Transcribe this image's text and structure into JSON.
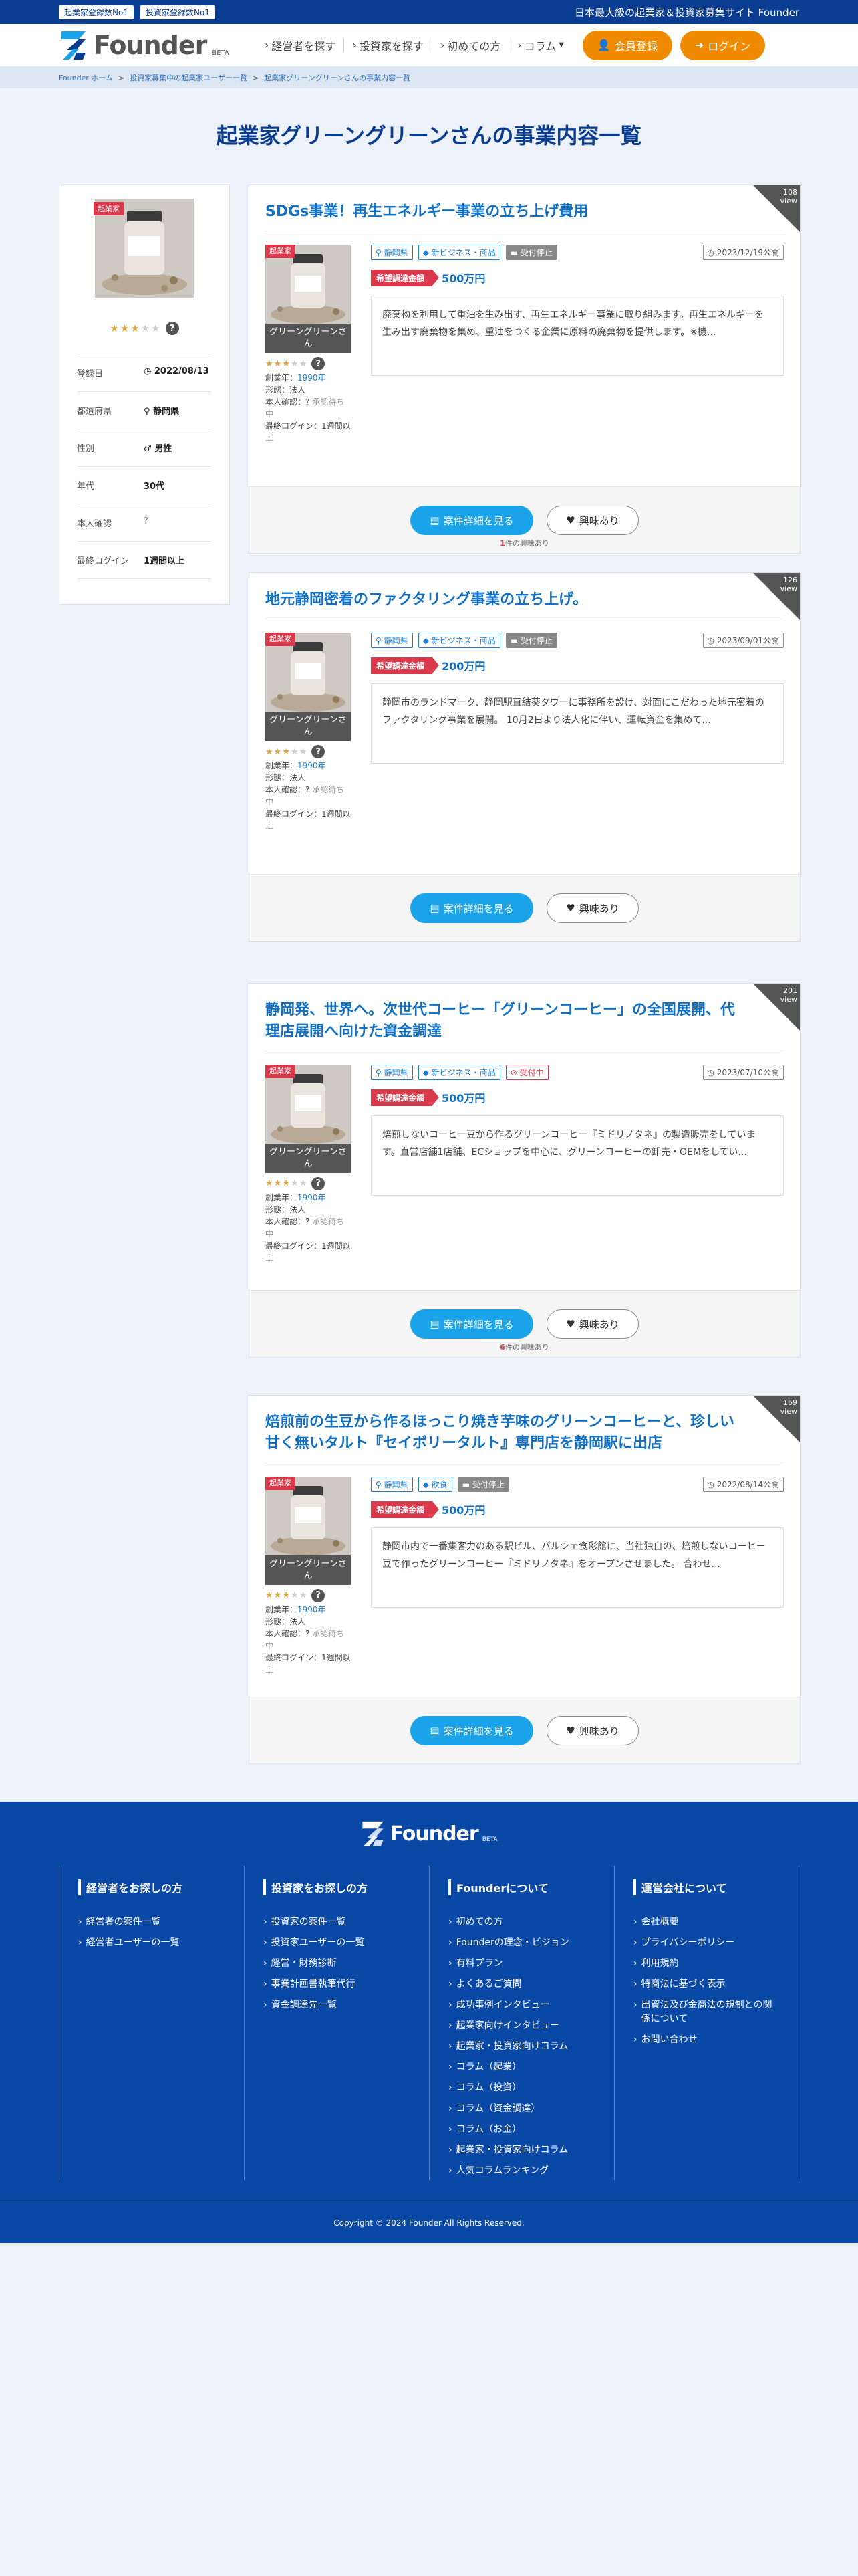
{
  "topbar": {
    "badge1": "起業家登録数No1",
    "badge2": "投資家登録数No1",
    "tagline": "日本最大級の起業家＆投資家募集サイト Founder"
  },
  "header": {
    "logo": "Founder",
    "beta": "BETA",
    "nav": [
      "経営者を探す",
      "投資家を探す",
      "初めての方",
      "コラム"
    ],
    "register": "会員登録",
    "login": "ログイン"
  },
  "breadcrumb": [
    "Founder ホーム",
    "投資家募集中の起業家ユーザー一覧",
    "起業家グリーングリーンさんの事業内容一覧"
  ],
  "page_title": "起業家グリーングリーンさんの事業内容一覧",
  "profile": {
    "tag": "起業家",
    "stars": 2.5,
    "q": "?",
    "rows": [
      {
        "k": "登録日",
        "v": "2022/08/13",
        "icon": "clock"
      },
      {
        "k": "都道府県",
        "v": "静岡県",
        "icon": "pin"
      },
      {
        "k": "性別",
        "v": "男性",
        "icon": "male"
      },
      {
        "k": "年代",
        "v": "30代",
        "icon": ""
      },
      {
        "k": "本人確認",
        "v": "?",
        "icon": ""
      },
      {
        "k": "最終ログイン",
        "v": "1週間以上",
        "icon": ""
      }
    ]
  },
  "cards": [
    {
      "title": "SDGs事業！再生エネルギー事業の立ち上げ費用",
      "views": "108",
      "view_label": "view",
      "tag": "起業家",
      "owner": "グリーングリーンさん",
      "founded_label": "創業年：",
      "founded": "1990年",
      "form": "形態：法人",
      "verify_label": "本人確認：?",
      "verify_status": "承認待ち中",
      "last_login": "最終ログイン：1週間以上",
      "pref": "静岡県",
      "category": "新ビジネス・商品",
      "status": "受付停止",
      "status_type": "gray",
      "date": "2023/12/19公開",
      "fund_label": "希望調達金額",
      "amount": "500万円",
      "desc": "廃棄物を利用して重油を生み出す、再生エネルギー事業に取り組みます。再生エネルギーを生み出す廃棄物を集め、重油をつくる企業に原料の廃棄物を提供します。※機...",
      "detail_btn": "案件詳細を見る",
      "interest_btn": "興味あり",
      "count": "1",
      "count_suffix": "件の興味あり"
    },
    {
      "title": "地元静岡密着のファクタリング事業の立ち上げ。",
      "views": "126",
      "view_label": "view",
      "tag": "起業家",
      "owner": "グリーングリーンさん",
      "founded_label": "創業年：",
      "founded": "1990年",
      "form": "形態：法人",
      "verify_label": "本人確認：?",
      "verify_status": "承認待ち中",
      "last_login": "最終ログイン：1週間以上",
      "pref": "静岡県",
      "category": "新ビジネス・商品",
      "status": "受付停止",
      "status_type": "gray",
      "date": "2023/09/01公開",
      "fund_label": "希望調達金額",
      "amount": "200万円",
      "desc": "静岡市のランドマーク、静岡駅直結葵タワーに事務所を設け、対面にこだわった地元密着のファクタリング事業を展開。 10月2日より法人化に伴い、運転資金を集めて...",
      "detail_btn": "案件詳細を見る",
      "interest_btn": "興味あり",
      "count": "",
      "count_suffix": ""
    },
    {
      "title": "静岡発、世界へ。次世代コーヒー「グリーンコーヒー」の全国展開、代理店展開へ向けた資金調達",
      "views": "201",
      "view_label": "view",
      "tag": "起業家",
      "owner": "グリーングリーンさん",
      "founded_label": "創業年：",
      "founded": "1990年",
      "form": "形態：法人",
      "verify_label": "本人確認：?",
      "verify_status": "承認待ち中",
      "last_login": "最終ログイン：1週間以上",
      "pref": "静岡県",
      "category": "新ビジネス・商品",
      "status": "受付中",
      "status_type": "red",
      "date": "2023/07/10公開",
      "fund_label": "希望調達金額",
      "amount": "500万円",
      "desc": "焙煎しないコーヒー豆から作るグリーンコーヒー『ミドリノタネ』の製造販売をしています。直営店舗1店舗、ECショップを中心に、グリーンコーヒーの卸売・OEMをしてい...",
      "detail_btn": "案件詳細を見る",
      "interest_btn": "興味あり",
      "count": "6",
      "count_suffix": "件の興味あり"
    },
    {
      "title": "焙煎前の生豆から作るほっこり焼き芋味のグリーンコーヒーと、珍しい甘く無いタルト『セイボリータルト』専門店を静岡駅に出店",
      "views": "169",
      "view_label": "view",
      "tag": "起業家",
      "owner": "グリーングリーンさん",
      "founded_label": "創業年：",
      "founded": "1990年",
      "form": "形態：法人",
      "verify_label": "本人確認：?",
      "verify_status": "承認待ち中",
      "last_login": "最終ログイン：1週間以上",
      "pref": "静岡県",
      "category": "飲食",
      "status": "受付停止",
      "status_type": "gray",
      "date": "2022/08/14公開",
      "fund_label": "希望調達金額",
      "amount": "500万円",
      "desc": "静岡市内で一番集客力のある駅ビル、パルシェ食彩館に、当社独自の、焙煎しないコーヒー豆で作ったグリーンコーヒー『ミドリノタネ』をオープンさせました。 合わせ...",
      "detail_btn": "案件詳細を見る",
      "interest_btn": "興味あり",
      "count": "",
      "count_suffix": ""
    }
  ],
  "footer": {
    "logo": "Founder",
    "beta": "BETA",
    "cols": [
      {
        "title": "経営者をお探しの方",
        "items": [
          "経営者の案件一覧",
          "経営者ユーザーの一覧"
        ]
      },
      {
        "title": "投資家をお探しの方",
        "items": [
          "投資家の案件一覧",
          "投資家ユーザーの一覧",
          "経営・財務診断",
          "事業計画書執筆代行",
          "資金調達先一覧"
        ]
      },
      {
        "title": "Founderについて",
        "items": [
          "初めての方",
          "Founderの理念・ビジョン",
          "有料プラン",
          "よくあるご質問",
          "成功事例インタビュー",
          "起業家向けインタビュー",
          "起業家・投資家向けコラム",
          "コラム（起業）",
          "コラム（投資）",
          "コラム（資金調達）",
          "コラム（お金）",
          "起業家・投資家向けコラム",
          "人気コラムランキング"
        ]
      },
      {
        "title": "運営会社について",
        "items": [
          "会社概要",
          "プライバシーポリシー",
          "利用規約",
          "特商法に基づく表示",
          "出資法及び金商法の規制との関係について",
          "お問い合わせ"
        ]
      }
    ],
    "copyright": "Copyright © 2024 Founder All Rights Reserved."
  },
  "colors": {
    "navy": "#0a3d91",
    "orange": "#f08a00",
    "blue": "#1270c4",
    "red": "#d9394b",
    "cyan": "#1aa3e8"
  }
}
